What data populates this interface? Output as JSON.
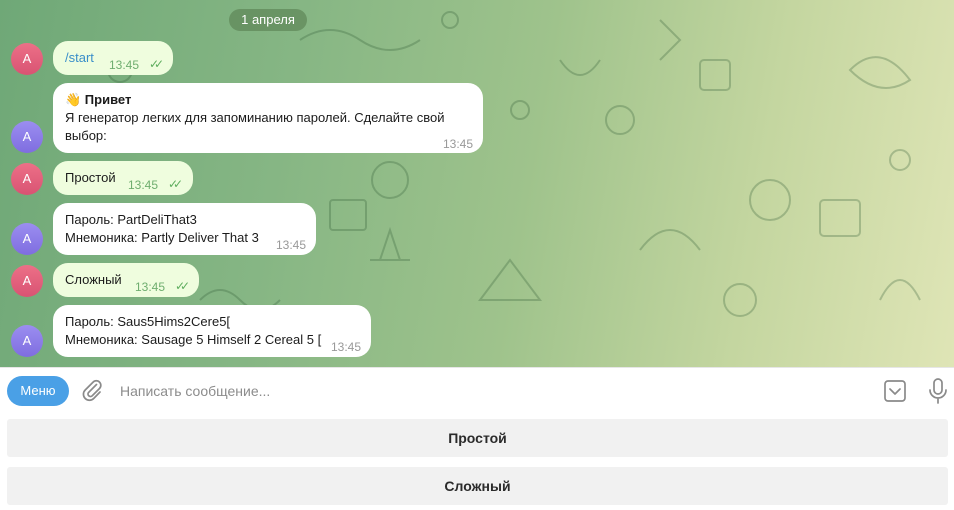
{
  "date_label": "1 апреля",
  "avatar_letter": "A",
  "messages": [
    {
      "dir": "out",
      "text": "/start",
      "time": "13:45"
    },
    {
      "dir": "in",
      "title": "👋 Привет",
      "line1": "Я генератор легких для запоминанию паролей. Сделайте свой",
      "line2": "выбор:",
      "time": "13:45"
    },
    {
      "dir": "out",
      "text": "Простой",
      "time": "13:45"
    },
    {
      "dir": "in",
      "line1": "Пароль: PartDeliThat3",
      "line2": "Мнемоника: Partly Deliver That 3",
      "time": "13:45"
    },
    {
      "dir": "out",
      "text": "Сложный",
      "time": "13:45"
    },
    {
      "dir": "in",
      "line1": "Пароль: Saus5Hims2Cere5[",
      "line2": "Мнемоника: Sausage 5 Himself 2 Cereal 5 [",
      "time": "13:45"
    }
  ],
  "composer": {
    "menu_label": "Меню",
    "placeholder": "Написать сообщение..."
  },
  "keyboard": [
    "Простой",
    "Сложный"
  ],
  "colors": {
    "accent": "#4aa0e6",
    "outgoing_bubble": "#effdde",
    "incoming_bubble": "#ffffff",
    "check_color": "#5fae5f"
  }
}
